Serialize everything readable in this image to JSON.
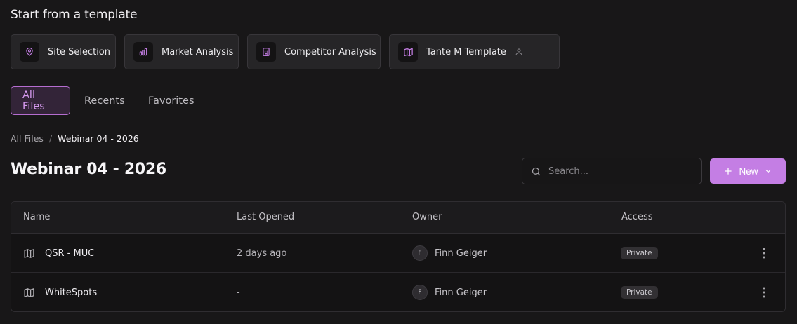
{
  "templates_section": {
    "title": "Start from a template",
    "items": [
      {
        "label": "Site Selection",
        "icon": "map-pin-icon"
      },
      {
        "label": "Market Analysis",
        "icon": "bar-chart-icon"
      },
      {
        "label": "Competitor Analysis",
        "icon": "building-icon"
      },
      {
        "label": "Tante M Template",
        "icon": "map-icon",
        "extra_icon": "user-icon"
      }
    ]
  },
  "tabs": [
    {
      "label": "All Files",
      "active": true
    },
    {
      "label": "Recents",
      "active": false
    },
    {
      "label": "Favorites",
      "active": false
    }
  ],
  "breadcrumb": {
    "root": "All Files",
    "separator": "/",
    "current": "Webinar 04 - 2026"
  },
  "page_title": "Webinar 04 - 2026",
  "search": {
    "placeholder": "Search..."
  },
  "new_button": {
    "label": "New"
  },
  "table": {
    "headers": {
      "name": "Name",
      "last_opened": "Last Opened",
      "owner": "Owner",
      "access": "Access"
    },
    "rows": [
      {
        "name": "QSR - MUC",
        "last_opened": "2 days ago",
        "owner_initial": "F",
        "owner": "Finn Geiger",
        "access": "Private"
      },
      {
        "name": "WhiteSpots",
        "last_opened": "-",
        "owner_initial": "F",
        "owner": "Finn Geiger",
        "access": "Private"
      }
    ]
  },
  "colors": {
    "accent": "#c47ee4",
    "accent_border": "#b56dd0",
    "background": "#181718"
  }
}
